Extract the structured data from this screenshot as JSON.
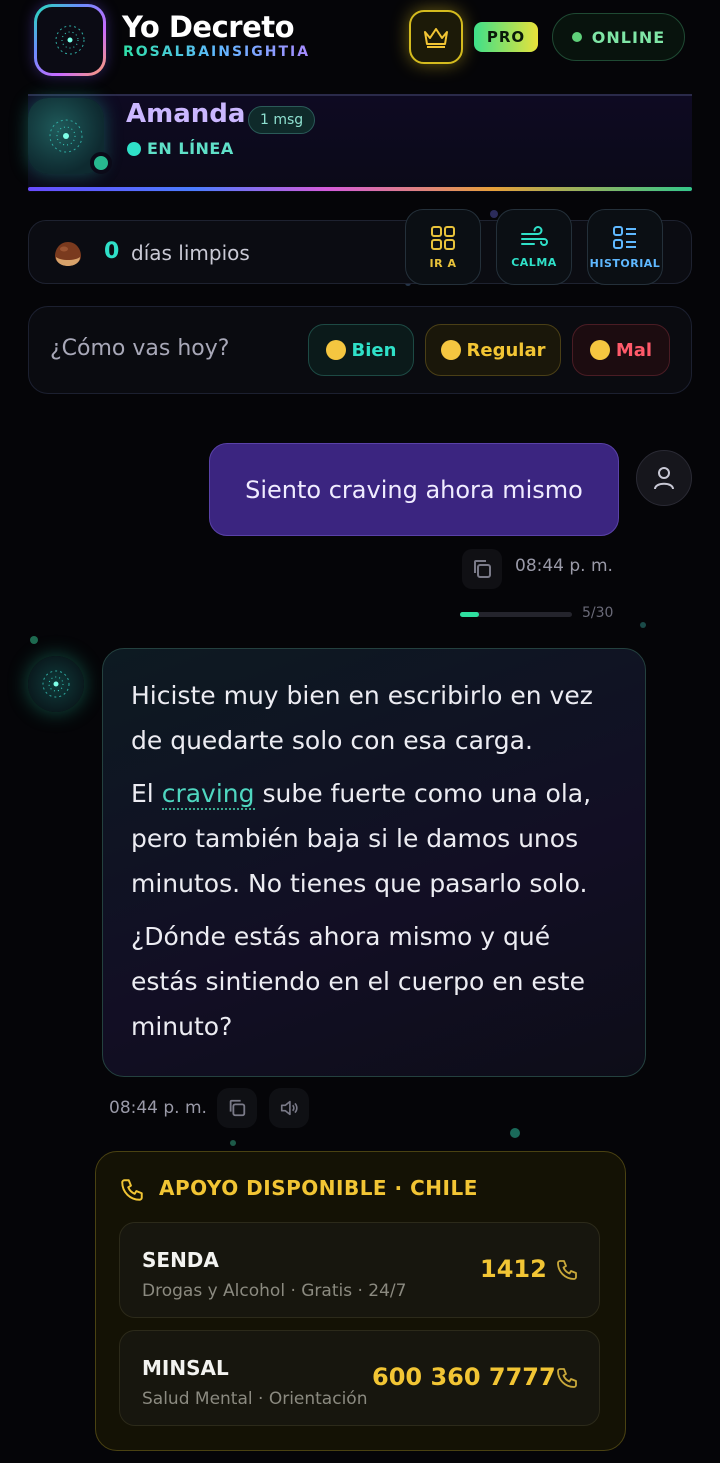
{
  "header": {
    "app_title": "Yo Decreto",
    "app_subtitle": "ROSALBAINSIGHTIA",
    "pro_label": "PRO",
    "online_label": "ONLINE"
  },
  "contact": {
    "name": "Amanda",
    "msg_count": "1 msg",
    "status": "EN LÍNEA"
  },
  "stats": {
    "days_count": "0",
    "days_label": "días limpios",
    "tools": [
      {
        "label": "IR A",
        "icon": "grid-icon"
      },
      {
        "label": "CALMA",
        "icon": "wind-icon"
      },
      {
        "label": "HISTORIAL",
        "icon": "list-icon"
      }
    ]
  },
  "mood": {
    "question": "¿Cómo vas hoy?",
    "options": [
      {
        "label": "Bien",
        "color": "#2fe0c8"
      },
      {
        "label": "Regular",
        "color": "#f2c534"
      },
      {
        "label": "Mal",
        "color": "#ff5a6a"
      }
    ]
  },
  "chat": {
    "user_message": "Siento craving ahora mismo",
    "user_time": "08:44 p. m.",
    "counter": "5/30",
    "counter_progress": 0.167,
    "bot_p1": "Hiciste muy bien en escribirlo en vez de quedarte solo con esa carga.",
    "bot_p2_pre": "El ",
    "bot_p2_kw": "craving",
    "bot_p2_post": " sube fuerte como una ola, pero también baja si le damos unos minutos. No tienes que pasarlo solo.",
    "bot_p3": "¿Dónde estás ahora mismo y qué estás sintiendo en el cuerpo en este minuto?",
    "bot_time": "08:44 p. m."
  },
  "support": {
    "title": "APOYO DISPONIBLE · CHILE",
    "lines": [
      {
        "name": "SENDA",
        "desc": "Drogas y Alcohol · Gratis · 24/7",
        "number": "1412"
      },
      {
        "name": "MINSAL",
        "desc": "Salud Mental · Orientación",
        "number": "600 360 7777"
      }
    ]
  },
  "colors": {
    "accent_teal": "#2fe0c8",
    "accent_gold": "#f2c534",
    "user_bubble": "#3b2580"
  }
}
